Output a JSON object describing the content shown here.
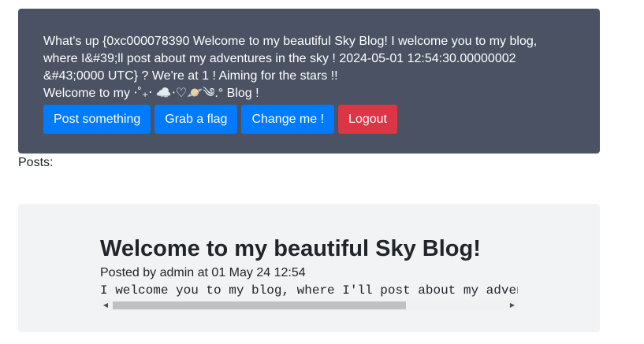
{
  "header": {
    "greeting": "What's up {0xc000078390 Welcome to my beautiful Sky Blog! I welcome you to my blog, where I&#39;ll post about my adventures in the sky ! 2024-05-01 12:54:30.00000002 &#43;0000 UTC} ? We're at 1 ! Aiming for the stars !!",
    "welcome": "Welcome to my ⋅˚₊‧ ☁️⋅♡🪐༄.° Blog !",
    "buttons": {
      "post": "Post something",
      "flag": "Grab a flag",
      "change": "Change me !",
      "logout": "Logout"
    },
    "colors": {
      "background": "#4a5263",
      "primary": "#007bff",
      "danger": "#dc3545"
    }
  },
  "posts": {
    "label": "Posts:",
    "items": [
      {
        "title": "Welcome to my beautiful Sky Blog!",
        "meta_prefix": "Posted by ",
        "author": "admin",
        "meta_mid": " at ",
        "date": "01 May 24 12:54",
        "body": "I welcome you to my blog, where I'll post about my adventures in the sky !"
      }
    ]
  },
  "icons": {
    "scroll_left": "arrow-left-icon",
    "scroll_right": "arrow-right-icon"
  }
}
